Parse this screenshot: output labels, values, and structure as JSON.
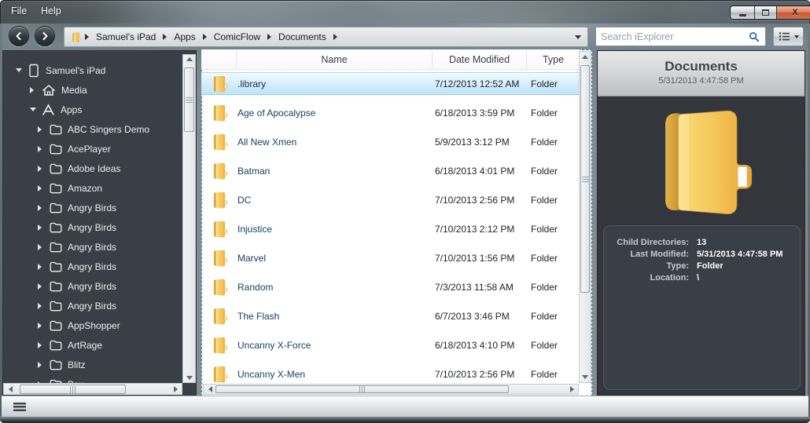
{
  "titlebar": {
    "menus": [
      {
        "label": "File"
      },
      {
        "label": "Help"
      }
    ],
    "controls": [
      "minimize",
      "maximize",
      "close"
    ]
  },
  "navbar": {
    "back_icon": "chevron-left",
    "forward_icon": "chevron-right",
    "breadcrumb": {
      "root_icon": "folder-icon",
      "items": [
        {
          "label": "Samuel's iPad"
        },
        {
          "label": "Apps"
        },
        {
          "label": "ComicFlow"
        },
        {
          "label": "Documents"
        }
      ]
    },
    "search": {
      "placeholder": "Search iExplorer",
      "icon": "magnifier"
    },
    "view_options_icon": "list-view"
  },
  "sidebar": {
    "items": [
      {
        "label": "Samuel's iPad",
        "icon": "ipad",
        "level": 0,
        "state": "expanded"
      },
      {
        "label": "Media",
        "icon": "home",
        "level": 1,
        "state": "collapsed"
      },
      {
        "label": "Apps",
        "icon": "apps",
        "level": 1,
        "state": "expanded"
      },
      {
        "label": "ABC Singers Demo",
        "icon": "folder",
        "level": 2,
        "state": "collapsed"
      },
      {
        "label": "AcePlayer",
        "icon": "folder",
        "level": 2,
        "state": "collapsed"
      },
      {
        "label": "Adobe Ideas",
        "icon": "folder",
        "level": 2,
        "state": "collapsed"
      },
      {
        "label": "Amazon",
        "icon": "folder",
        "level": 2,
        "state": "collapsed"
      },
      {
        "label": "Angry Birds",
        "icon": "folder",
        "level": 2,
        "state": "collapsed"
      },
      {
        "label": "Angry Birds",
        "icon": "folder",
        "level": 2,
        "state": "collapsed"
      },
      {
        "label": "Angry Birds",
        "icon": "folder",
        "level": 2,
        "state": "collapsed"
      },
      {
        "label": "Angry Birds",
        "icon": "folder",
        "level": 2,
        "state": "collapsed"
      },
      {
        "label": "Angry Birds",
        "icon": "folder",
        "level": 2,
        "state": "collapsed"
      },
      {
        "label": "Angry Birds",
        "icon": "folder",
        "level": 2,
        "state": "collapsed"
      },
      {
        "label": "AppShopper",
        "icon": "folder",
        "level": 2,
        "state": "collapsed"
      },
      {
        "label": "ArtRage",
        "icon": "folder",
        "level": 2,
        "state": "collapsed"
      },
      {
        "label": "Blitz",
        "icon": "folder",
        "level": 2,
        "state": "collapsed"
      },
      {
        "label": "Box",
        "icon": "folder",
        "level": 2,
        "state": "collapsed"
      }
    ]
  },
  "filelist": {
    "columns": [
      {
        "label": "Name"
      },
      {
        "label": "Date Modified"
      },
      {
        "label": "Type"
      }
    ],
    "rows": [
      {
        "name": ".library",
        "date_modified": "7/12/2013 12:52 AM",
        "type": "Folder",
        "selected": true
      },
      {
        "name": "Age of Apocalypse",
        "date_modified": "6/18/2013 3:59 PM",
        "type": "Folder",
        "selected": false
      },
      {
        "name": "All New Xmen",
        "date_modified": "5/9/2013 3:12 PM",
        "type": "Folder",
        "selected": false
      },
      {
        "name": "Batman",
        "date_modified": "6/18/2013 4:01 PM",
        "type": "Folder",
        "selected": false
      },
      {
        "name": "DC",
        "date_modified": "7/10/2013 2:56 PM",
        "type": "Folder",
        "selected": false
      },
      {
        "name": "Injustice",
        "date_modified": "7/10/2013 2:12 PM",
        "type": "Folder",
        "selected": false
      },
      {
        "name": "Marvel",
        "date_modified": "7/10/2013 1:56 PM",
        "type": "Folder",
        "selected": false
      },
      {
        "name": "Random",
        "date_modified": "7/3/2013 11:58 AM",
        "type": "Folder",
        "selected": false
      },
      {
        "name": "The Flash",
        "date_modified": "6/7/2013 3:46 PM",
        "type": "Folder",
        "selected": false
      },
      {
        "name": "Uncanny X-Force",
        "date_modified": "6/18/2013 4:10 PM",
        "type": "Folder",
        "selected": false
      },
      {
        "name": "Uncanny X-Men",
        "date_modified": "7/10/2013 2:56 PM",
        "type": "Folder",
        "selected": false
      }
    ]
  },
  "preview": {
    "title": "Documents",
    "subtitle": "5/31/2013 4:47:58 PM",
    "icon": "big-folder-icon",
    "fields": [
      {
        "label": "Child Directories:",
        "value": "13"
      },
      {
        "label": "Last Modified:",
        "value": "5/31/2013 4:47:58 PM"
      },
      {
        "label": "Type:",
        "value": "Folder"
      },
      {
        "label": "Location:",
        "value": "\\"
      }
    ]
  },
  "colors": {
    "selection_blue": "#bfe3f7",
    "folder_yellow": "#f0bf4e",
    "sidebar_bg": "#3a3e46",
    "close_red": "#cf6a4c",
    "file_name_text": "#1d3f61"
  }
}
